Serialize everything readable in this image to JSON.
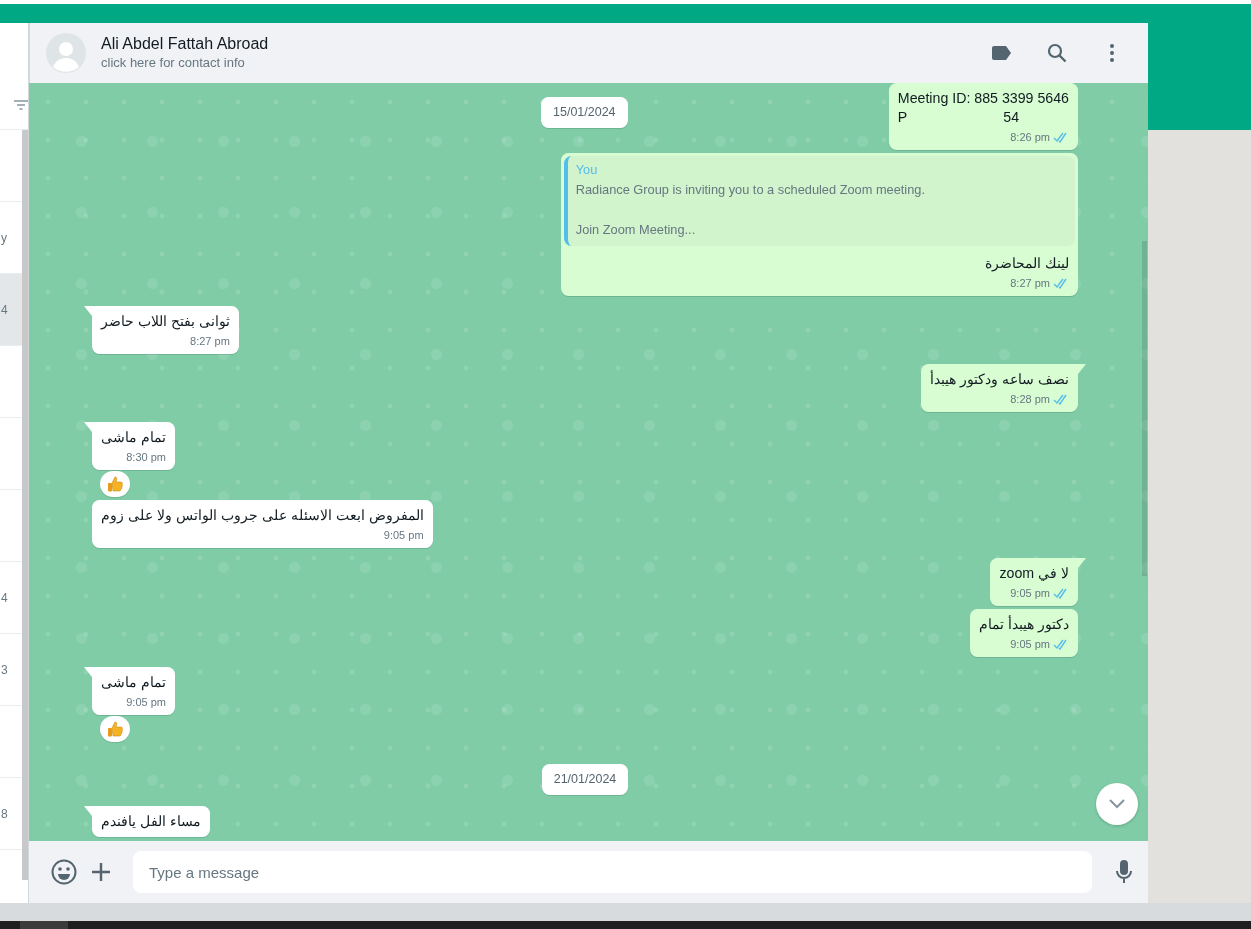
{
  "sidebar": {
    "items": [
      {
        "selected": false
      },
      {
        "text": "y",
        "selected": false
      },
      {
        "text": "4",
        "selected": true
      },
      {
        "selected": false
      },
      {
        "selected": false
      },
      {
        "selected": false
      },
      {
        "text": "4",
        "selected": false
      },
      {
        "text": "3",
        "selected": false
      },
      {
        "selected": false
      },
      {
        "text": "8",
        "selected": false
      }
    ]
  },
  "header": {
    "name": "Ali Abdel Fattah Abroad",
    "subtitle": "click here for contact info"
  },
  "sticky_date": "15/01/2024",
  "messages": [
    {
      "kind": "covered",
      "outgoing": true,
      "tail": false,
      "lines": [
        "Meeting ID: 885 3399 5646"
      ],
      "covered_start": "P",
      "covered_end": "54",
      "time": "8:26 pm",
      "read": true
    },
    {
      "kind": "reply",
      "outgoing": true,
      "tail": false,
      "quote_author": "You",
      "quote_lines": [
        "Radiance Group is inviting you to a scheduled Zoom meeting.",
        "Join Zoom Meeting..."
      ],
      "text": "لينك المحاضرة",
      "time": "8:27 pm",
      "read": true
    },
    {
      "kind": "text",
      "outgoing": false,
      "tail": true,
      "text": "ثوانى بفتح اللاب حاضر",
      "time": "8:27 pm"
    },
    {
      "kind": "text",
      "outgoing": true,
      "tail": true,
      "text": "نصف ساعه ودكتور هيبدأ",
      "time": "8:28 pm",
      "read": true
    },
    {
      "kind": "text",
      "outgoing": false,
      "tail": true,
      "text": "تمام ماشى",
      "time": "8:30 pm",
      "reacted": true
    },
    {
      "kind": "text",
      "outgoing": false,
      "tail": false,
      "text": "المفروض ابعت الاسئله على جروب الواتس ولا على زوم",
      "time": "9:05 pm"
    },
    {
      "kind": "text",
      "outgoing": true,
      "tail": true,
      "text": "لا في zoom",
      "time": "9:05 pm",
      "read": true
    },
    {
      "kind": "text",
      "outgoing": true,
      "tail": false,
      "text": "دكتور هيبدأ تمام",
      "time": "9:05 pm",
      "read": true
    },
    {
      "kind": "text",
      "outgoing": false,
      "tail": true,
      "text": "تمام ماشى",
      "time": "9:05 pm",
      "reacted": true
    },
    {
      "kind": "date",
      "text": "21/01/2024"
    },
    {
      "kind": "text",
      "outgoing": false,
      "tail": true,
      "text": "مساء الفل يافندم"
    }
  ],
  "composer": {
    "placeholder": "Type a message"
  }
}
